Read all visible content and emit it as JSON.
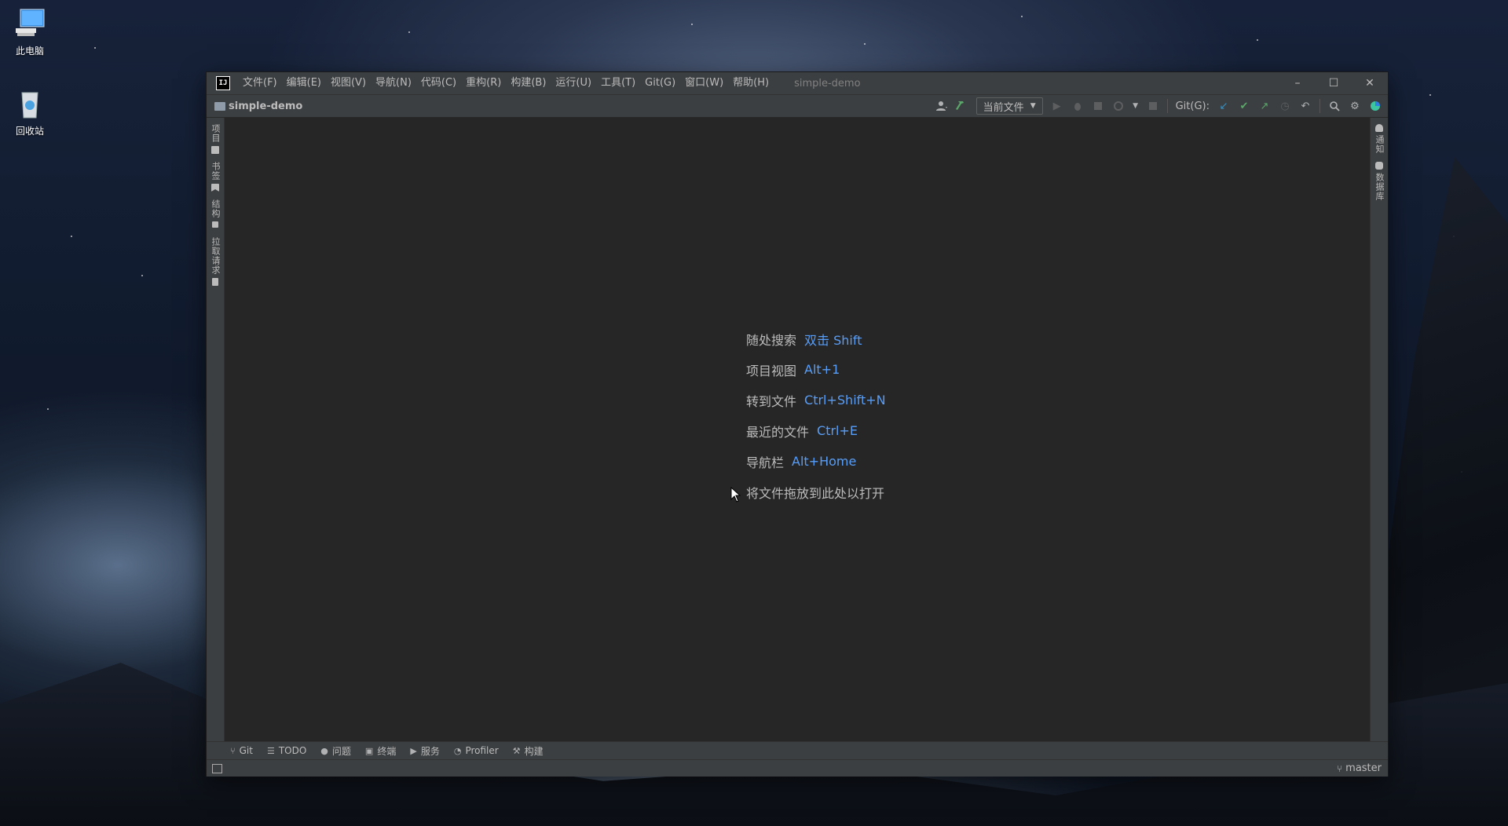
{
  "desktop": {
    "icons": [
      {
        "label": "此电脑",
        "icon": "computer-icon"
      },
      {
        "label": "回收站",
        "icon": "recycle-bin-icon"
      }
    ]
  },
  "window": {
    "title": "simple-demo",
    "app_icon": "IJ",
    "menu": [
      "文件(F)",
      "编辑(E)",
      "视图(V)",
      "导航(N)",
      "代码(C)",
      "重构(R)",
      "构建(B)",
      "运行(U)",
      "工具(T)",
      "Git(G)",
      "窗口(W)",
      "帮助(H)"
    ],
    "controls": {
      "minimize": "–",
      "maximize": "☐",
      "close": "✕"
    }
  },
  "navbar": {
    "breadcrumb": "simple-demo",
    "run_config": "当前文件",
    "git_label": "Git(G):"
  },
  "left_tool_tabs": [
    "项目",
    "书签",
    "结构",
    "拉取请求"
  ],
  "right_tool_tabs": [
    "通知",
    "数据库"
  ],
  "editor": {
    "hints": [
      {
        "label": "随处搜索",
        "key": "双击 Shift"
      },
      {
        "label": "项目视图",
        "key": "Alt+1"
      },
      {
        "label": "转到文件",
        "key": "Ctrl+Shift+N"
      },
      {
        "label": "最近的文件",
        "key": "Ctrl+E"
      },
      {
        "label": "导航栏",
        "key": "Alt+Home"
      },
      {
        "label": "将文件拖放到此处以打开",
        "key": ""
      }
    ]
  },
  "bottom_tabs": [
    {
      "label": "Git",
      "icon": "branch-icon"
    },
    {
      "label": "TODO",
      "icon": "list-icon"
    },
    {
      "label": "问题",
      "icon": "info-icon"
    },
    {
      "label": "终端",
      "icon": "terminal-icon"
    },
    {
      "label": "服务",
      "icon": "play-circle-icon"
    },
    {
      "label": "Profiler",
      "icon": "profiler-icon"
    },
    {
      "label": "构建",
      "icon": "hammer-icon"
    }
  ],
  "statusbar": {
    "branch": "master"
  },
  "colors": {
    "accent_blue": "#589df6",
    "editor_bg": "#262626",
    "chrome_bg": "#3c3f41"
  }
}
